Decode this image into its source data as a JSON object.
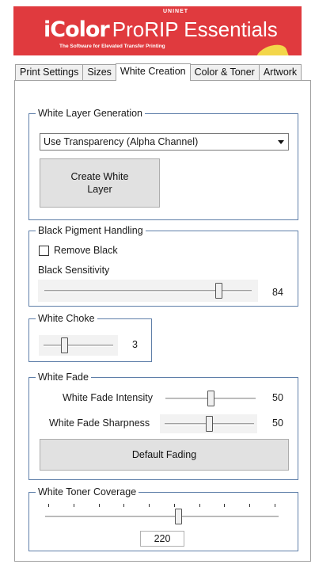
{
  "banner": {
    "company": "UNINET",
    "brand": "iColor",
    "product": "ProRIP Essentials",
    "tagline": "The Software for Elevated Transfer Printing"
  },
  "tabs": [
    {
      "label": "Print Settings",
      "active": false
    },
    {
      "label": "Sizes",
      "active": false
    },
    {
      "label": "White Creation",
      "active": true
    },
    {
      "label": "Color & Toner",
      "active": false
    },
    {
      "label": "Artwork",
      "active": false
    }
  ],
  "white_layer": {
    "legend": "White Layer Generation",
    "mode_selected": "Use Transparency (Alpha Channel)",
    "create_button": "Create White Layer"
  },
  "black_pigment": {
    "legend": "Black Pigment Handling",
    "remove_black_label": "Remove Black",
    "remove_black_checked": false,
    "sensitivity_label": "Black Sensitivity",
    "sensitivity_value": "84",
    "sensitivity_fraction": 0.84
  },
  "white_choke": {
    "legend": "White Choke",
    "value": "3",
    "fraction": 0.3
  },
  "white_fade": {
    "legend": "White Fade",
    "intensity_label": "White Fade Intensity",
    "intensity_value": "50",
    "intensity_fraction": 0.5,
    "sharpness_label": "White Fade Sharpness",
    "sharpness_value": "50",
    "sharpness_fraction": 0.5,
    "default_button": "Default Fading"
  },
  "toner_coverage": {
    "legend": "White Toner Coverage",
    "value": "220",
    "fraction": 0.57
  }
}
